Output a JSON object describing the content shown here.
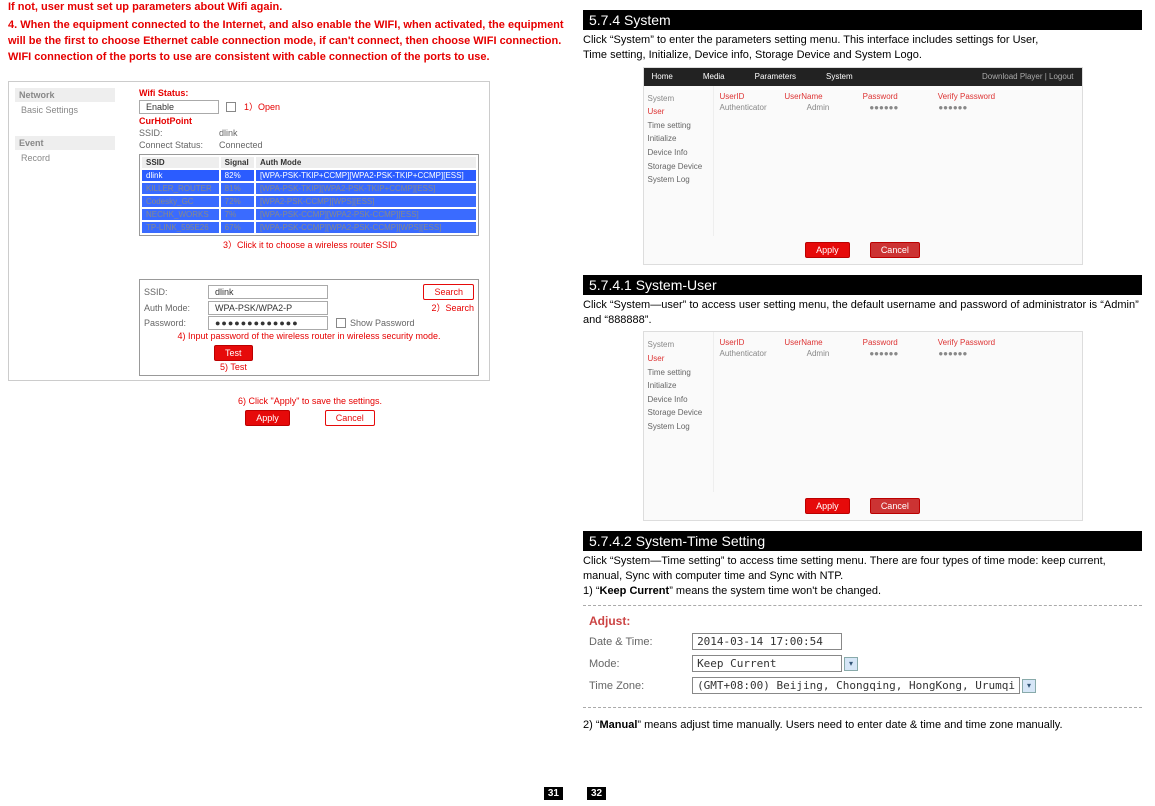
{
  "left": {
    "warn1": "If not, user must set up parameters about Wifi again.",
    "warn2": "4. When the equipment connected to the Internet, and also enable the WIFI, when activated, the equipment will be the first to choose Ethernet cable connection mode, if can't connect, then choose WIFI connection. WIFI connection of the ports to use are consistent with cable connection of the ports to use.",
    "sidemenu": {
      "network": "Network",
      "basic": "Basic Settings",
      "event": "Event",
      "record": "Record"
    },
    "wifi": {
      "status_lbl": "Wifi Status:",
      "enable": "Enable",
      "open": "1）Open",
      "curhot": "CurHotPoint",
      "ssid_lbl": "SSID:",
      "ssid_val": "dlink",
      "conn_lbl": "Connect Status:",
      "conn_val": "Connected",
      "th_ssid": "SSID",
      "th_signal": "Signal",
      "th_auth": "Auth Mode",
      "r1a": "dlink",
      "r1b": "82%",
      "r1c": "[WPA-PSK-TKIP+CCMP][WPA2-PSK-TKIP+CCMP][ESS]",
      "r2a": "KILLER_ROUTER",
      "r2b": "81%",
      "r2c": "[WPA-PSK-TKIP][WPA2-PSK-TKIP+CCMP][ESS]",
      "r3a": "Codesky_GC",
      "r3b": "72%",
      "r3c": "[WPA2-PSK-CCMP][WPS][ESS]",
      "r4a": "NECHK_WORKS",
      "r4b": "7%",
      "r4c": "[WPA-PSK-CCMP][WPA2-PSK-CCMP][ESS]",
      "r5a": "TP-LINK_595E26",
      "r5b": "67%",
      "r5c": "[WPA-PSK-CCMP][WPA2-PSK-CCMP][WPS][ESS]",
      "tip3": "3）Click it to choose a wireless router SSID",
      "ssid2_lbl": "SSID:",
      "ssid2_val": "dlink",
      "search": "Search",
      "tip2": "2）Search",
      "auth_lbl": "Auth Mode:",
      "auth_val": "WPA-PSK/WPA2-P",
      "pwd_lbl": "Password:",
      "pwd_val": "●●●●●●●●●●●●●",
      "showpwd": "Show Password",
      "tip4": "4) Input password of the wireless router in wireless security mode.",
      "test": "Test",
      "tip5": "5) Test",
      "tip6": "6) Click \"Apply\" to save the settings.",
      "apply": "Apply",
      "cancel": "Cancel"
    },
    "pagenum": "31"
  },
  "right": {
    "h1": "5.7.4 System",
    "t1": "Click “System” to enter the parameters setting menu. This interface includes settings for User,",
    "t1b": " Time setting, Initialize, Device info, Storage Device and System Logo.",
    "h2": "5.7.4.1 System-User",
    "t2": "Click “System—user” to access user setting menu, the default username and password of administrator is “Admin” and “888888”.",
    "h3": "5.7.4.2 System-Time Setting",
    "t3a": "Click “System—Time setting” to access time setting menu. There are four types of time mode: keep current, manual, Sync with computer time and Sync with NTP.",
    "t3b_pre": "1) “",
    "t3b_bold": "Keep Current",
    "t3b_post": "” means the system time won't be changed.",
    "adjust": "Adjust:",
    "dtlbl": "Date & Time:",
    "dtval": "2014-03-14 17:00:54",
    "mdlbl": "Mode:",
    "mdval": "Keep Current",
    "tzlbl": "Time Zone:",
    "tzval": "(GMT+08:00) Beijing, Chongqing, HongKong, Urumqi",
    "t4_pre": "2) “",
    "t4_bold": "Manual",
    "t4_post": "” means adjust time manually. Users need to enter date & time and time zone manually.",
    "pagenum": "32",
    "sys": {
      "nav_home": "Home",
      "nav_media": "Media",
      "nav_param": "Parameters",
      "nav_sys": "System",
      "nav_dl": "Download Player | Logout",
      "side_title": "System",
      "s_user": "User",
      "s_time": "Time setting",
      "s_init": "Initialize",
      "s_dev": "Device Info",
      "s_store": "Storage Device",
      "s_log": "System Log",
      "col_uid": "UserID",
      "col_uname": "UserName",
      "col_pwd": "Password",
      "col_vpwd": "Verify Password",
      "row_auth": "Authenticator",
      "row_admin": "Admin",
      "row_mask": "●●●●●●",
      "apply": "Apply",
      "cancel": "Cancel"
    }
  }
}
